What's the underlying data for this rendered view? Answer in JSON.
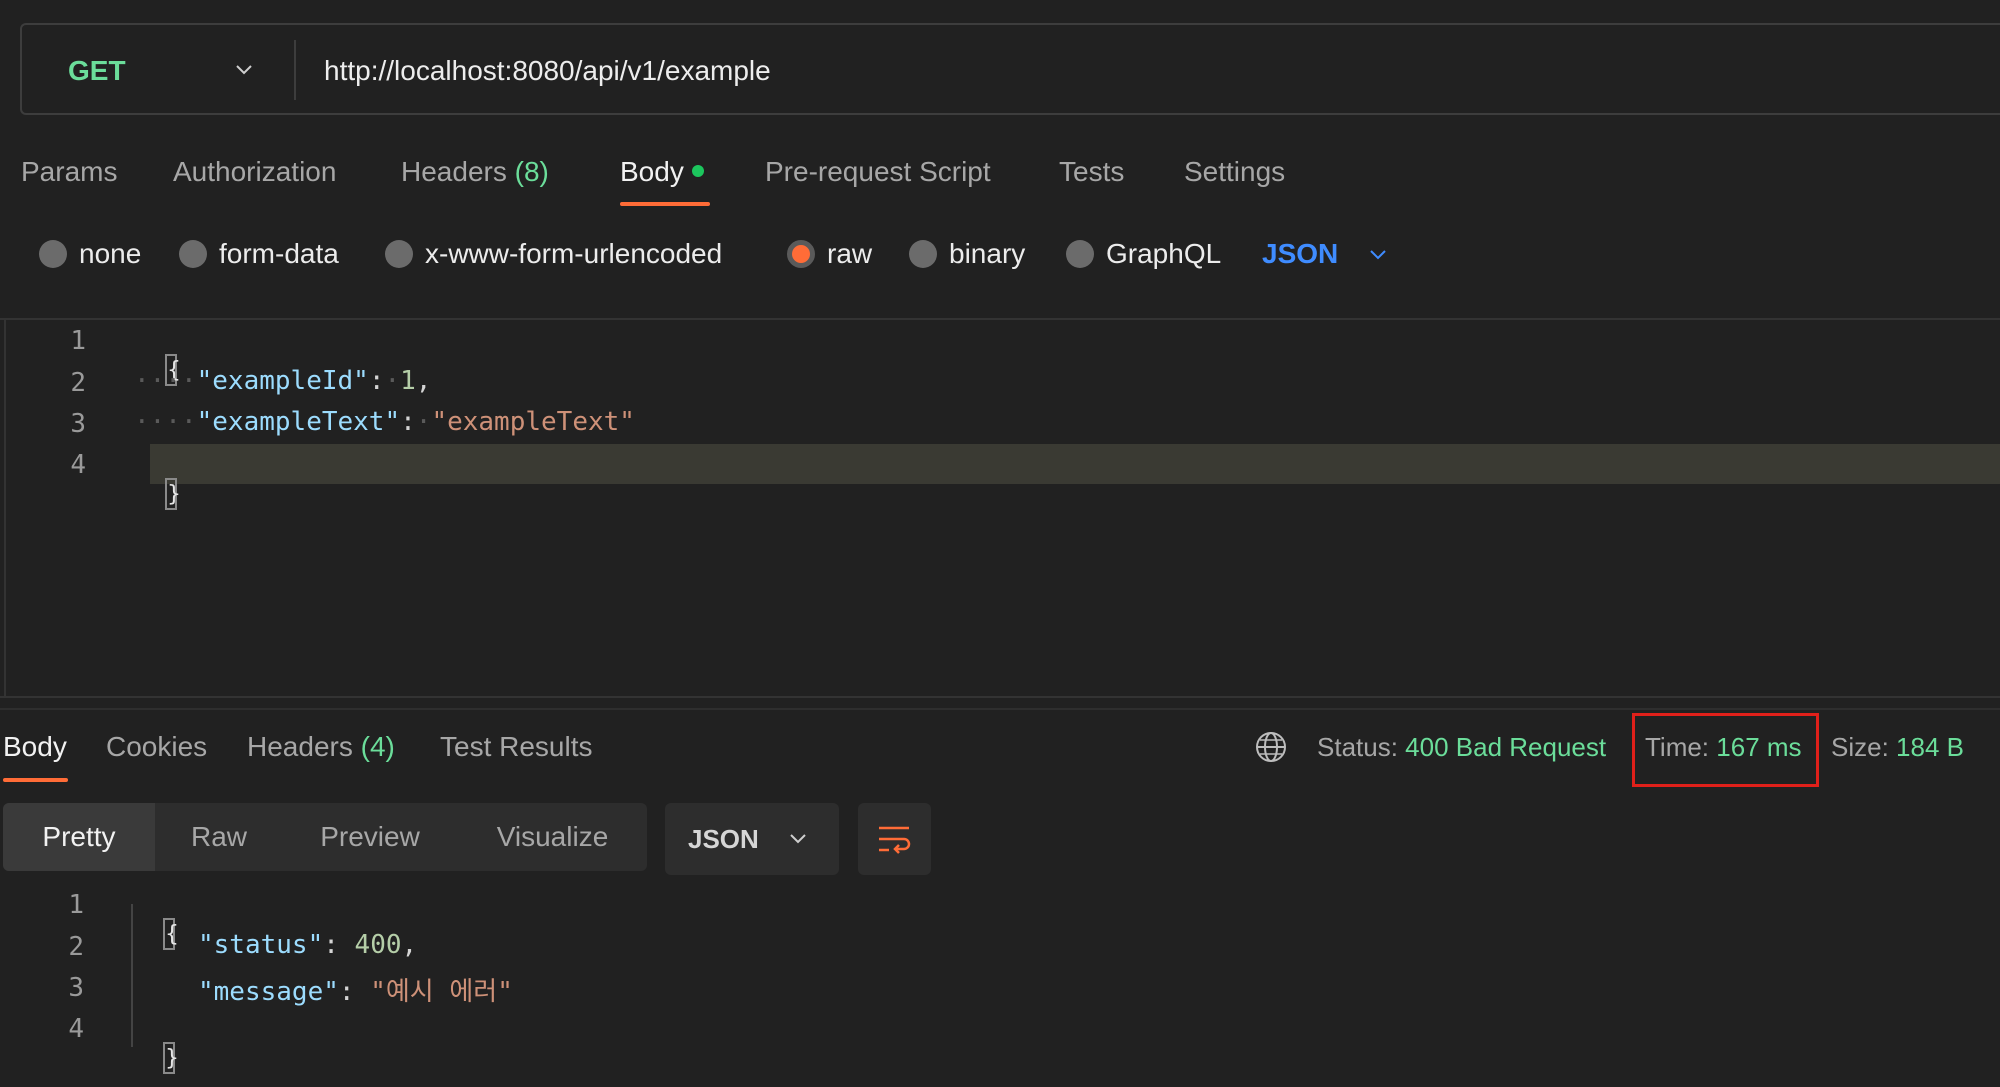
{
  "request": {
    "method": "GET",
    "url": "http://localhost:8080/api/v1/example",
    "tabs": [
      {
        "label": "Params"
      },
      {
        "label": "Authorization"
      },
      {
        "label": "Headers",
        "count": "(8)"
      },
      {
        "label": "Body"
      },
      {
        "label": "Pre-request Script"
      },
      {
        "label": "Tests"
      },
      {
        "label": "Settings"
      }
    ],
    "active_tab": "Body",
    "body_types": [
      "none",
      "form-data",
      "x-www-form-urlencoded",
      "raw",
      "binary",
      "GraphQL"
    ],
    "selected_body_type": "raw",
    "format": "JSON",
    "editor": {
      "line_numbers": [
        "1",
        "2",
        "3",
        "4"
      ],
      "open_brace": "{",
      "close_brace": "}",
      "lines": [
        {
          "key": "\"exampleId\"",
          "value": "1"
        },
        {
          "key": "\"exampleText\"",
          "value": "\"exampleText\""
        }
      ]
    }
  },
  "response": {
    "tabs": [
      {
        "label": "Body"
      },
      {
        "label": "Cookies"
      },
      {
        "label": "Headers",
        "count": "(4)"
      },
      {
        "label": "Test Results"
      }
    ],
    "active_tab": "Body",
    "status_label": "Status:",
    "status_value": "400 Bad Request",
    "time_label": "Time:",
    "time_value": "167 ms",
    "size_label": "Size:",
    "size_value": "184 B",
    "view_modes": [
      "Pretty",
      "Raw",
      "Preview",
      "Visualize"
    ],
    "active_view": "Pretty",
    "format": "JSON",
    "body": {
      "line_numbers": [
        "1",
        "2",
        "3",
        "4"
      ],
      "open_brace": "{",
      "close_brace": "}",
      "lines": [
        {
          "key": "\"status\"",
          "value": "400"
        },
        {
          "key": "\"message\"",
          "value": "\"예시 에러\""
        }
      ]
    }
  },
  "colors": {
    "background": "#212121",
    "accent": "#ff6c37",
    "method_get": "#6bdd9a",
    "status_value": "#6bdd9a",
    "json_select": "#3f8cff",
    "highlight_box": "#e0201a"
  },
  "icons": [
    "chevron-down-icon",
    "globe-icon",
    "wrap-lines-icon"
  ]
}
